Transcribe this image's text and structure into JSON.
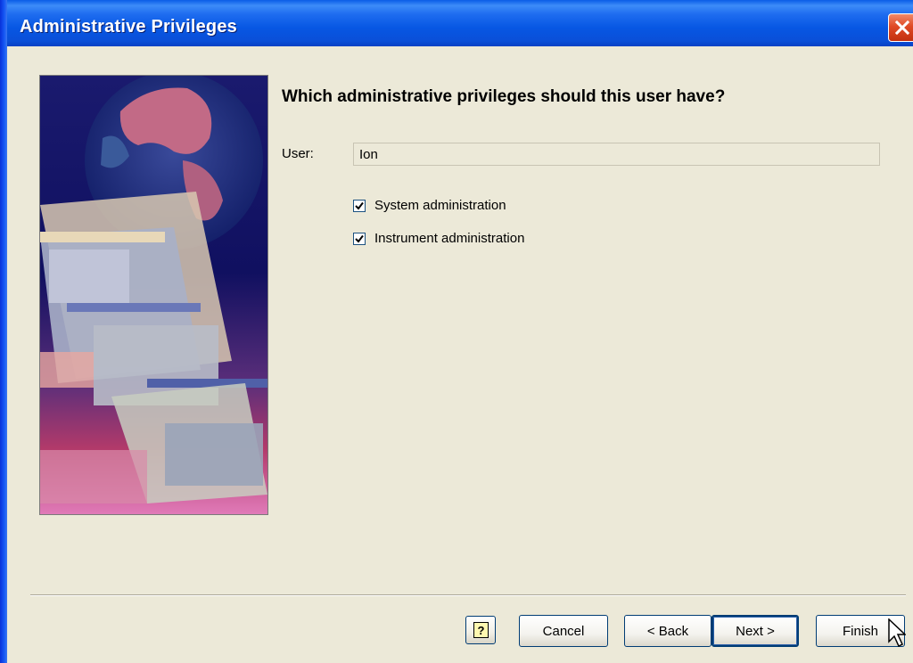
{
  "window": {
    "title": "Administrative Privileges",
    "close_icon": "close-icon",
    "accent_color": "#0757e3"
  },
  "main": {
    "heading": "Which administrative privileges should this user have?",
    "user_label": "User:",
    "user_value": "Ion",
    "options": [
      {
        "label": "System administration",
        "checked": true
      },
      {
        "label": "Instrument administration",
        "checked": true
      }
    ]
  },
  "footer": {
    "help_icon": "help-icon",
    "help_glyph": "?",
    "cancel_label": "Cancel",
    "back_label": "< Back",
    "next_label": "Next >",
    "finish_label": "Finish"
  }
}
